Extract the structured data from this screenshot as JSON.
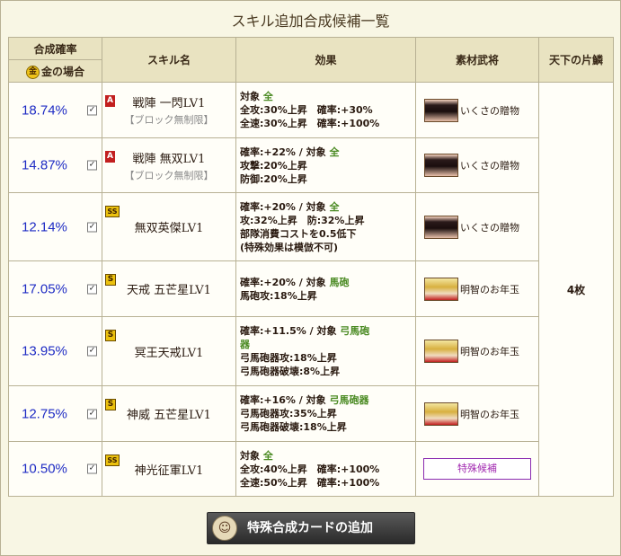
{
  "title": "スキル追加合成候補一覧",
  "headers": {
    "rate": "合成確率",
    "gold": "金の場合",
    "coin_icon": "金",
    "skill": "スキル名",
    "effect": "効果",
    "material": "素材武将",
    "count": "天下の片鱗"
  },
  "count_value": "4枚",
  "rows": [
    {
      "rate": "18.74%",
      "badge": "A",
      "name": "戦陣 一閃LV1",
      "sub": "【ブロック無制限】",
      "effect": [
        [
          {
            "t": "対象 "
          },
          {
            "t": "全",
            "g": true
          }
        ],
        [
          {
            "t": "全攻:30%上昇　確率:+30%"
          }
        ],
        [
          {
            "t": "全速:30%上昇　確率:+100%"
          }
        ]
      ],
      "material": "いくさの贈物",
      "portrait": "k"
    },
    {
      "rate": "14.87%",
      "badge": "A",
      "name": "戦陣 無双LV1",
      "sub": "【ブロック無制限】",
      "effect": [
        [
          {
            "t": "確率:+22% / 対象 "
          },
          {
            "t": "全",
            "g": true
          }
        ],
        [
          {
            "t": "攻撃:20%上昇"
          }
        ],
        [
          {
            "t": "防御:20%上昇"
          }
        ]
      ],
      "material": "いくさの贈物",
      "portrait": "k"
    },
    {
      "rate": "12.14%",
      "badge": "SS",
      "name": "無双英傑LV1",
      "sub": "",
      "effect": [
        [
          {
            "t": "確率:+20% / 対象 "
          },
          {
            "t": "全",
            "g": true
          }
        ],
        [
          {
            "t": "攻:32%上昇　防:32%上昇"
          }
        ],
        [
          {
            "t": "部隊消費コストを0.5低下"
          }
        ],
        [
          {
            "t": "(特殊効果は模倣不可)"
          }
        ]
      ],
      "material": "いくさの贈物",
      "portrait": "k"
    },
    {
      "rate": "17.05%",
      "badge": "S",
      "name": "天戒 五芒星LV1",
      "sub": "",
      "effect": [
        [
          {
            "t": "確率:+20% / 対象 "
          },
          {
            "t": "馬砲",
            "g": true
          }
        ],
        [
          {
            "t": "馬砲攻:18%上昇"
          }
        ]
      ],
      "material": "明智のお年玉",
      "portrait": "g"
    },
    {
      "rate": "13.95%",
      "badge": "S",
      "name": "冥王天戒LV1",
      "sub": "",
      "effect": [
        [
          {
            "t": "確率:+11.5% / 対象 "
          },
          {
            "t": "弓馬砲",
            "g": true
          }
        ],
        [
          {
            "t": "器",
            "g": true
          }
        ],
        [
          {
            "t": "弓馬砲器攻:18%上昇"
          }
        ],
        [
          {
            "t": "弓馬砲器破壊:8%上昇"
          }
        ]
      ],
      "material": "明智のお年玉",
      "portrait": "g"
    },
    {
      "rate": "12.75%",
      "badge": "S",
      "name": "神威 五芒星LV1",
      "sub": "",
      "effect": [
        [
          {
            "t": "確率:+16% / 対象 "
          },
          {
            "t": "弓馬砲器",
            "g": true
          }
        ],
        [
          {
            "t": "弓馬砲器攻:35%上昇"
          }
        ],
        [
          {
            "t": "弓馬砲器破壊:18%上昇"
          }
        ]
      ],
      "material": "明智のお年玉",
      "portrait": "g"
    },
    {
      "rate": "10.50%",
      "badge": "SS",
      "name": "神光征軍LV1",
      "sub": "",
      "effect": [
        [
          {
            "t": "対象 "
          },
          {
            "t": "全",
            "g": true
          }
        ],
        [
          {
            "t": "全攻:40%上昇　確率:+100%"
          }
        ],
        [
          {
            "t": "全速:50%上昇　確率:+100%"
          }
        ]
      ],
      "material": "特殊候補",
      "material_type": "button"
    }
  ],
  "button": {
    "label": "特殊合成カードの追加",
    "face_icon": "☺"
  }
}
